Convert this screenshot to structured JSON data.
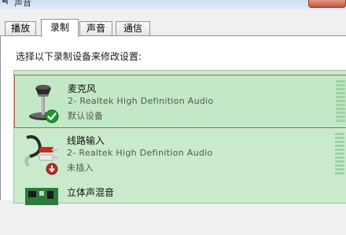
{
  "window": {
    "title": "声音"
  },
  "tabs": [
    {
      "label": "播放",
      "active": false
    },
    {
      "label": "录制",
      "active": true
    },
    {
      "label": "声音",
      "active": false
    },
    {
      "label": "通信",
      "active": false
    }
  ],
  "instruction": "选择以下录制设备来修改设置:",
  "devices": [
    {
      "name": "麦克风",
      "description": "2- Realtek High Definition Audio",
      "status": "默认设备",
      "icon": "microphone-icon",
      "badge": "default-check-icon",
      "selected": true
    },
    {
      "name": "线路输入",
      "description": "2- Realtek High Definition Audio",
      "status": "未插入",
      "icon": "line-in-jack-icon",
      "badge": "unplugged-icon",
      "selected": false
    },
    {
      "name": "立体声混音",
      "description": "",
      "status": "",
      "icon": "sound-card-icon",
      "badge": "",
      "selected": false
    }
  ],
  "colors": {
    "list_background": "#c9ebcc",
    "selection_border": "#c25b4e",
    "check_badge": "#1e9a2e",
    "unplugged_badge": "#b0322a"
  }
}
